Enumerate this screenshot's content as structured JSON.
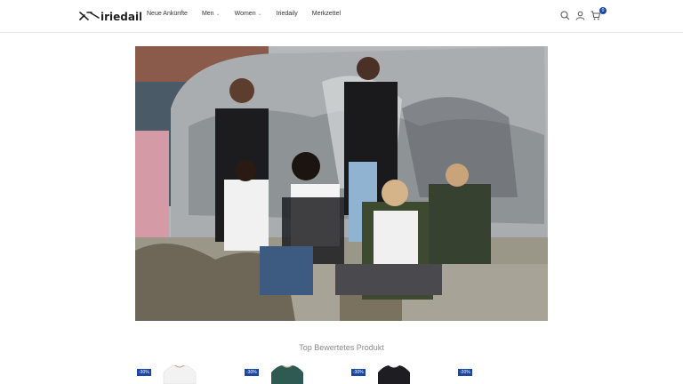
{
  "header": {
    "logo_text": "iriedaily",
    "nav": [
      {
        "label": "Neue Ankünfte",
        "has_dropdown": false
      },
      {
        "label": "Men",
        "has_dropdown": true
      },
      {
        "label": "Women",
        "has_dropdown": true
      },
      {
        "label": "Iriedaily",
        "has_dropdown": false
      },
      {
        "label": "Merkzettel",
        "has_dropdown": false
      }
    ],
    "icons": [
      "search-icon",
      "user-icon",
      "cart-icon"
    ],
    "cart_count": "0"
  },
  "hero": {
    "image": "group-photo-airstream"
  },
  "section": {
    "title": "Top Bewertetes Produkt"
  },
  "products": [
    {
      "badge": "-30%",
      "color": "#f2f2f2"
    },
    {
      "badge": "-30%",
      "color": "#2f5a52"
    },
    {
      "badge": "-30%",
      "color": "#1e1e22"
    },
    {
      "badge": "-20%",
      "color": "#ffffff"
    }
  ],
  "colors": {
    "accent": "#1d47a5"
  }
}
